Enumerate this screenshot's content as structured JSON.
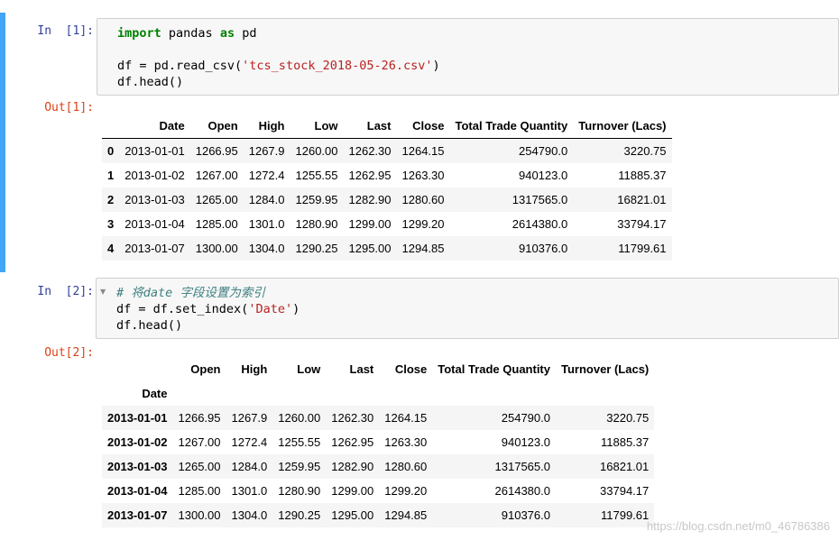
{
  "cell1": {
    "in_prompt": "In  [1]:",
    "out_prompt": "Out[1]:",
    "code_line1_kw1": "import",
    "code_line1_mid": " pandas ",
    "code_line1_kw2": "as",
    "code_line1_end": " pd",
    "code_line3_pre": "df = pd.read_csv(",
    "code_line3_str": "'tcs_stock_2018-05-26.csv'",
    "code_line3_post": ")",
    "code_line4": "df.head()",
    "table": {
      "columns": [
        "",
        "Date",
        "Open",
        "High",
        "Low",
        "Last",
        "Close",
        "Total Trade Quantity",
        "Turnover (Lacs)"
      ],
      "rows": [
        [
          "0",
          "2013-01-01",
          "1266.95",
          "1267.9",
          "1260.00",
          "1262.30",
          "1264.15",
          "254790.0",
          "3220.75"
        ],
        [
          "1",
          "2013-01-02",
          "1267.00",
          "1272.4",
          "1255.55",
          "1262.95",
          "1263.30",
          "940123.0",
          "11885.37"
        ],
        [
          "2",
          "2013-01-03",
          "1265.00",
          "1284.0",
          "1259.95",
          "1282.90",
          "1280.60",
          "1317565.0",
          "16821.01"
        ],
        [
          "3",
          "2013-01-04",
          "1285.00",
          "1301.0",
          "1280.90",
          "1299.00",
          "1299.20",
          "2614380.0",
          "33794.17"
        ],
        [
          "4",
          "2013-01-07",
          "1300.00",
          "1304.0",
          "1290.25",
          "1295.00",
          "1294.85",
          "910376.0",
          "11799.61"
        ]
      ]
    }
  },
  "cell2": {
    "in_prompt": "In  [2]:",
    "out_prompt": "Out[2]:",
    "code_line1_comment": "# 将date 字段设置为索引",
    "code_line2_pre": "df = df.set_index(",
    "code_line2_str": "'Date'",
    "code_line2_post": ")",
    "code_line3": "df.head()",
    "table": {
      "columns": [
        "",
        "Open",
        "High",
        "Low",
        "Last",
        "Close",
        "Total Trade Quantity",
        "Turnover (Lacs)"
      ],
      "index_name": "Date",
      "rows": [
        [
          "2013-01-01",
          "1266.95",
          "1267.9",
          "1260.00",
          "1262.30",
          "1264.15",
          "254790.0",
          "3220.75"
        ],
        [
          "2013-01-02",
          "1267.00",
          "1272.4",
          "1255.55",
          "1262.95",
          "1263.30",
          "940123.0",
          "11885.37"
        ],
        [
          "2013-01-03",
          "1265.00",
          "1284.0",
          "1259.95",
          "1282.90",
          "1280.60",
          "1317565.0",
          "16821.01"
        ],
        [
          "2013-01-04",
          "1285.00",
          "1301.0",
          "1280.90",
          "1299.00",
          "1299.20",
          "2614380.0",
          "33794.17"
        ],
        [
          "2013-01-07",
          "1300.00",
          "1304.0",
          "1290.25",
          "1295.00",
          "1294.85",
          "910376.0",
          "11799.61"
        ]
      ]
    }
  },
  "watermark": "https://blog.csdn.net/m0_46786386"
}
